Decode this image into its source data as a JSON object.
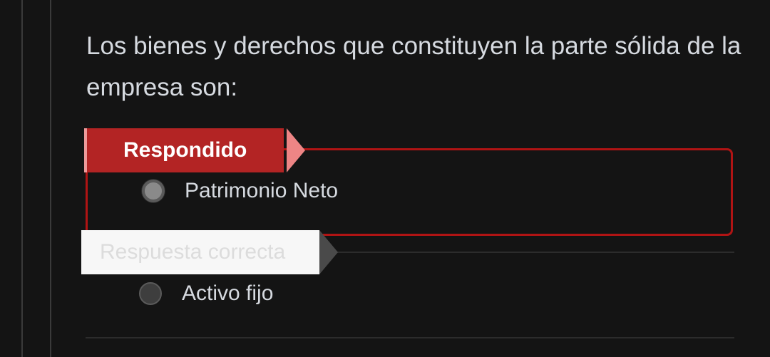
{
  "question": {
    "text": "Los bienes y derechos que constituyen la parte sólida de la empresa son:"
  },
  "answered": {
    "flag_label": "Respondido",
    "option_label": "Patrimonio Neto",
    "option_selected": true
  },
  "correct": {
    "flag_label": "Respuesta correcta",
    "option_label": "Activo fijo",
    "option_selected": false
  },
  "colors": {
    "background": "#141414",
    "wrong_accent": "#b01414",
    "flag_answered": "#b32424",
    "flag_correct": "#f7f7f7",
    "text": "#d6dae0"
  }
}
